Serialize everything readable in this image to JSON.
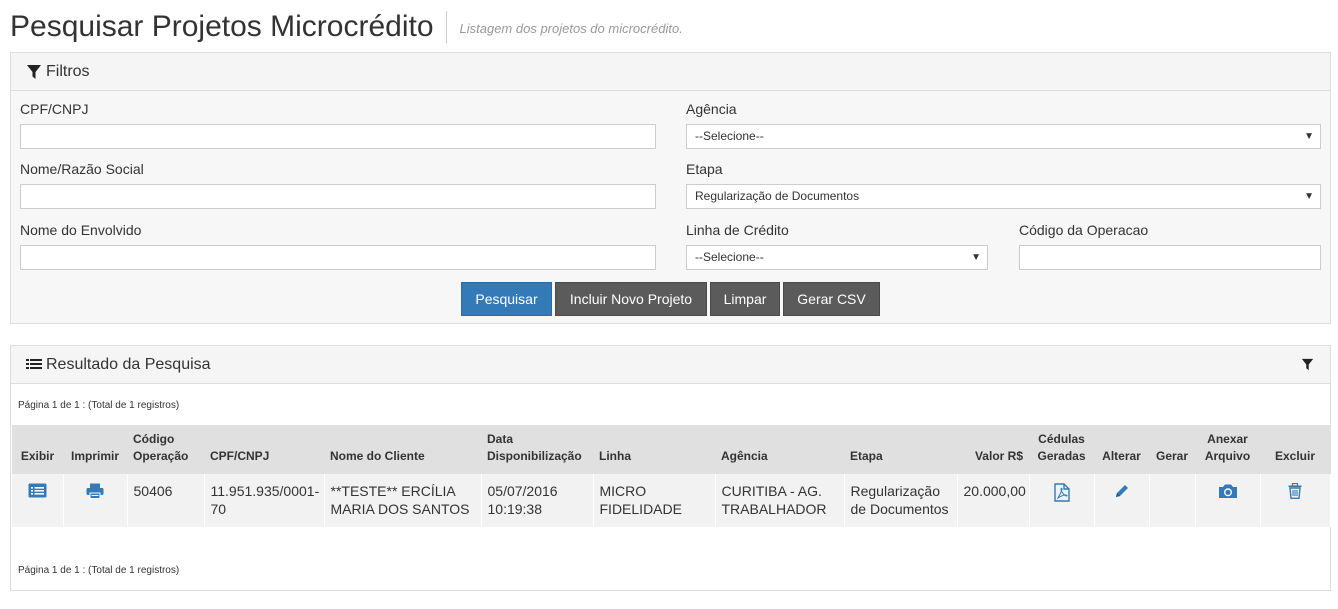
{
  "header": {
    "title": "Pesquisar Projetos Microcrédito",
    "subtitle": "Listagem dos projetos do microcrédito."
  },
  "filters": {
    "heading": "Filtros",
    "cpf_label": "CPF/CNPJ",
    "cpf_value": "",
    "agencia_label": "Agência",
    "agencia_value": "--Selecione--",
    "nome_label": "Nome/Razão Social",
    "nome_value": "",
    "etapa_label": "Etapa",
    "etapa_value": "Regularização de Documentos",
    "envolvido_label": "Nome do Envolvido",
    "envolvido_value": "",
    "linha_label": "Linha de Crédito",
    "linha_value": "--Selecione--",
    "codigo_label": "Código da Operacao",
    "codigo_value": ""
  },
  "buttons": {
    "pesquisar": "Pesquisar",
    "incluir": "Incluir Novo Projeto",
    "limpar": "Limpar",
    "csv": "Gerar CSV"
  },
  "results": {
    "heading": "Resultado da Pesquisa",
    "pagination_top": "Página 1 de 1 : (Total de 1 registros)",
    "pagination_bottom": "Página 1 de 1 : (Total de 1 registros)",
    "columns": {
      "exibir": "Exibir",
      "imprimir": "Imprimir",
      "codigo_1": "Código",
      "codigo_2": "Operação",
      "cpf": "CPF/CNPJ",
      "nome": "Nome do Cliente",
      "data_1": "Data",
      "data_2": "Disponibilização",
      "linha": "Linha",
      "agencia": "Agência",
      "etapa": "Etapa",
      "valor": "Valor R$",
      "cedulas_1": "Cédulas",
      "cedulas_2": "Geradas",
      "alterar": "Alterar",
      "gerar": "Gerar",
      "anexar_1": "Anexar",
      "anexar_2": "Arquivo",
      "excluir": "Excluir"
    },
    "rows": [
      {
        "codigo": "50406",
        "cpf_1": "11.951.935/0001-",
        "cpf_2": "70",
        "nome_1": "**TESTE** ERCÍLIA",
        "nome_2": "MARIA DOS SANTOS",
        "data_1": "05/07/2016",
        "data_2": "10:19:38",
        "linha_1": "MICRO",
        "linha_2": "FIDELIDADE",
        "agencia_1": "CURITIBA - AG.",
        "agencia_2": "TRABALHADOR",
        "etapa_1": "Regularização",
        "etapa_2": "de Documentos",
        "valor": "20.000,00"
      }
    ]
  },
  "icons": {
    "filter": "filter-icon",
    "list": "list-icon",
    "exibir": "list-alt-icon",
    "imprimir": "print-icon",
    "cedulas": "pdf-file-icon",
    "alterar": "pencil-icon",
    "anexar": "camera-icon",
    "excluir": "trash-icon"
  },
  "colors": {
    "primary": "#337ab7",
    "dark_button": "#5b5b5b",
    "icon_blue": "#337ab7"
  }
}
